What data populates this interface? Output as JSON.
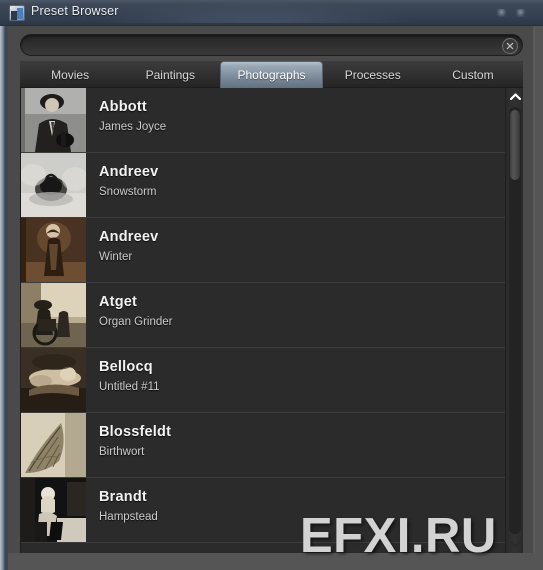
{
  "window": {
    "title": "Preset Browser",
    "icon": "picture-icon",
    "controls": [
      {
        "name": "minimize-button",
        "glyph": "minimize"
      },
      {
        "name": "maximize-button",
        "glyph": "maximize"
      }
    ]
  },
  "search": {
    "value": "",
    "placeholder": "",
    "clear_icon": "clear-circle-icon"
  },
  "tabs": [
    {
      "label": "Movies",
      "active": false
    },
    {
      "label": "Paintings",
      "active": false
    },
    {
      "label": "Photographs",
      "active": true
    },
    {
      "label": "Processes",
      "active": false
    },
    {
      "label": "Custom",
      "active": false
    }
  ],
  "list": {
    "items": [
      {
        "title": "Abbott",
        "subtitle": "James Joyce",
        "thumb": "abbott-james-joyce-thumbnail"
      },
      {
        "title": "Andreev",
        "subtitle": "Snowstorm",
        "thumb": "andreev-snowstorm-thumbnail"
      },
      {
        "title": "Andreev",
        "subtitle": "Winter",
        "thumb": "andreev-winter-thumbnail"
      },
      {
        "title": "Atget",
        "subtitle": "Organ Grinder",
        "thumb": "atget-organ-grinder-thumbnail"
      },
      {
        "title": "Bellocq",
        "subtitle": "Untitled #11",
        "thumb": "bellocq-untitled-11-thumbnail"
      },
      {
        "title": "Blossfeldt",
        "subtitle": "Birthwort",
        "thumb": "blossfeldt-birthwort-thumbnail"
      },
      {
        "title": "Brandt",
        "subtitle": "Hampstead",
        "thumb": "brandt-hampstead-thumbnail"
      }
    ]
  },
  "scrollbar": {
    "up_icon": "chevron-up-icon",
    "down_icon": "chevron-down-icon"
  },
  "watermark": {
    "text": "EFXI.RU"
  },
  "colors": {
    "titlebar": "#3d4857",
    "panel": "#4a4a4b",
    "list_background": "#2b2b2c",
    "active_tab": "#8e9daa",
    "title_text": "#f2f2f2",
    "subtitle_text": "#cbcbcb"
  }
}
